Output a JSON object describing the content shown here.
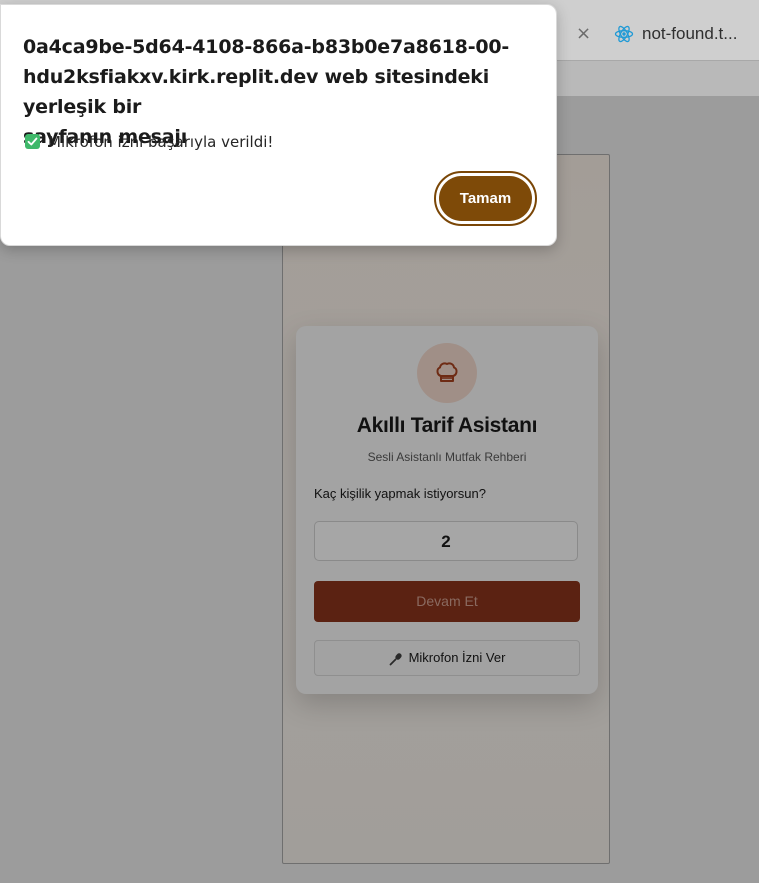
{
  "browser": {
    "tab_close": "×",
    "tab_title": "not-found.t..."
  },
  "app": {
    "title": "Akıllı Tarif Asistanı",
    "subtitle": "Sesli Asistanlı Mutfak Rehberi",
    "question": "Kaç kişilik yapmak istiyorsun?",
    "people_value": "2",
    "continue_label": "Devam Et",
    "mic_label": "Mikrofon İzni Ver"
  },
  "dialog": {
    "title_lines": [
      "0a4ca9be-5d64-4108-866a-b83b0e7a8618-00-",
      "hdu2ksfiakxv.kirk.replit.dev web sitesindeki yerleşik bir",
      "sayfanın mesajı"
    ],
    "message": "Mikrofon izni başarıyla verildi!",
    "ok_label": "Tamam"
  },
  "colors": {
    "ok_button": "#7e4a08",
    "check": "#3fb86a",
    "primary_button": "#5b2212"
  }
}
